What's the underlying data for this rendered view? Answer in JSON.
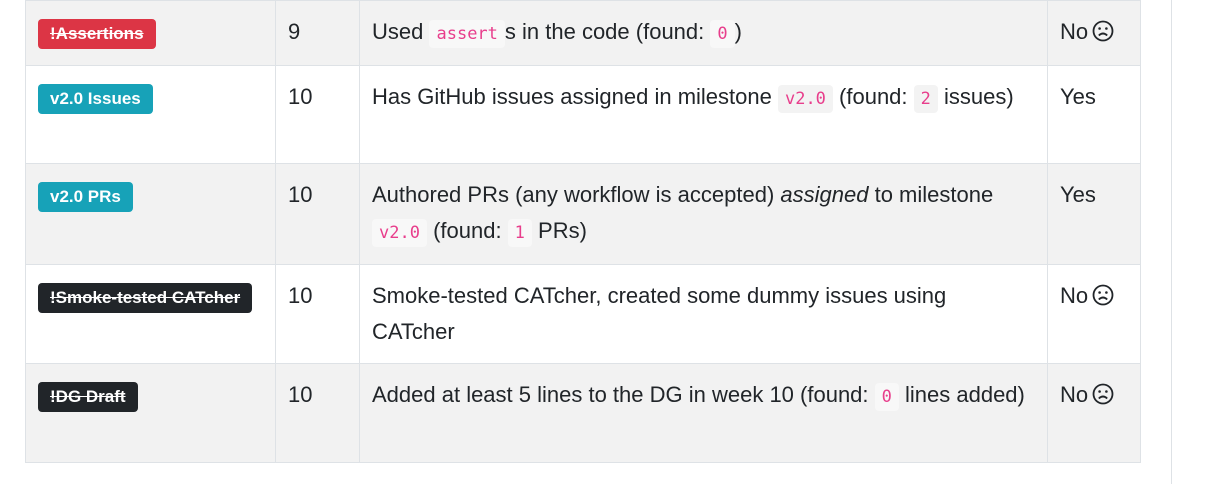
{
  "rows": [
    {
      "badge": "!Assertions",
      "points": "9",
      "desc": [
        "Used ",
        "assert",
        "s in the code (found: ",
        "0",
        ")"
      ],
      "status": "No",
      "sad": true
    },
    {
      "badge": "v2.0 Issues",
      "points": "10",
      "desc": [
        "Has GitHub issues assigned in milestone ",
        "v2.0",
        " (found: ",
        "2",
        " issues)"
      ],
      "status": "Yes",
      "sad": false
    },
    {
      "badge": "v2.0 PRs",
      "points": "10",
      "desc": [
        "Authored PRs (any workflow is accepted) ",
        "assigned",
        " to milestone ",
        "v2.0",
        " (found: ",
        "1",
        " PRs)"
      ],
      "status": "Yes",
      "sad": false
    },
    {
      "badge": "!Smoke-tested CATcher",
      "points": "10",
      "desc": [
        "Smoke-tested CATcher, created some dummy issues using CATcher"
      ],
      "status": "No",
      "sad": true
    },
    {
      "badge": "!DG Draft",
      "points": "10",
      "desc": [
        "Added at least 5 lines to the DG in week 10 (found: ",
        "0",
        " lines added)"
      ],
      "status": "No",
      "sad": true
    }
  ],
  "colors": {
    "badge_red": "#dc3545",
    "badge_teal": "#17a2b8",
    "badge_dark": "#212529",
    "code_text": "#e83e8c"
  }
}
